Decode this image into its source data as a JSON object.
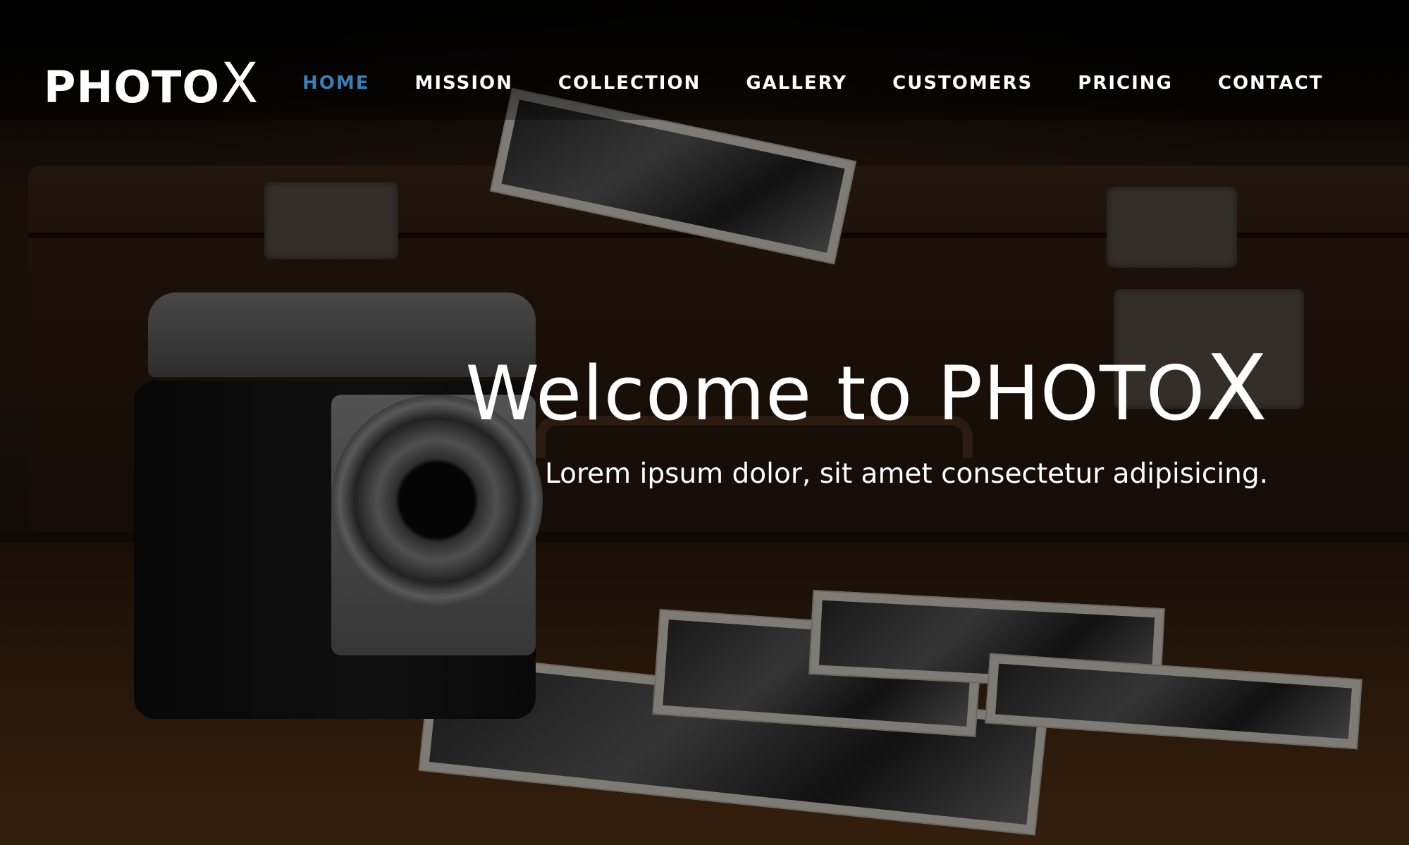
{
  "brand": {
    "logo_main": "PHOTO",
    "logo_accent": "X"
  },
  "nav": {
    "items": [
      {
        "label": "HOME",
        "active": true
      },
      {
        "label": "MISSION",
        "active": false
      },
      {
        "label": "COLLECTION",
        "active": false
      },
      {
        "label": "GALLERY",
        "active": false
      },
      {
        "label": "CUSTOMERS",
        "active": false
      },
      {
        "label": "PRICING",
        "active": false
      },
      {
        "label": "CONTACT",
        "active": false
      }
    ],
    "active_color": "#3d7db0",
    "text_color": "#ffffff"
  },
  "hero": {
    "title_main": "Welcome to PHOTO",
    "title_accent": "X",
    "subtitle": "Lorem ipsum dolor, sit amet consectetur adipisicing.",
    "background_image": "vintage-camera-suitcase-photos"
  }
}
